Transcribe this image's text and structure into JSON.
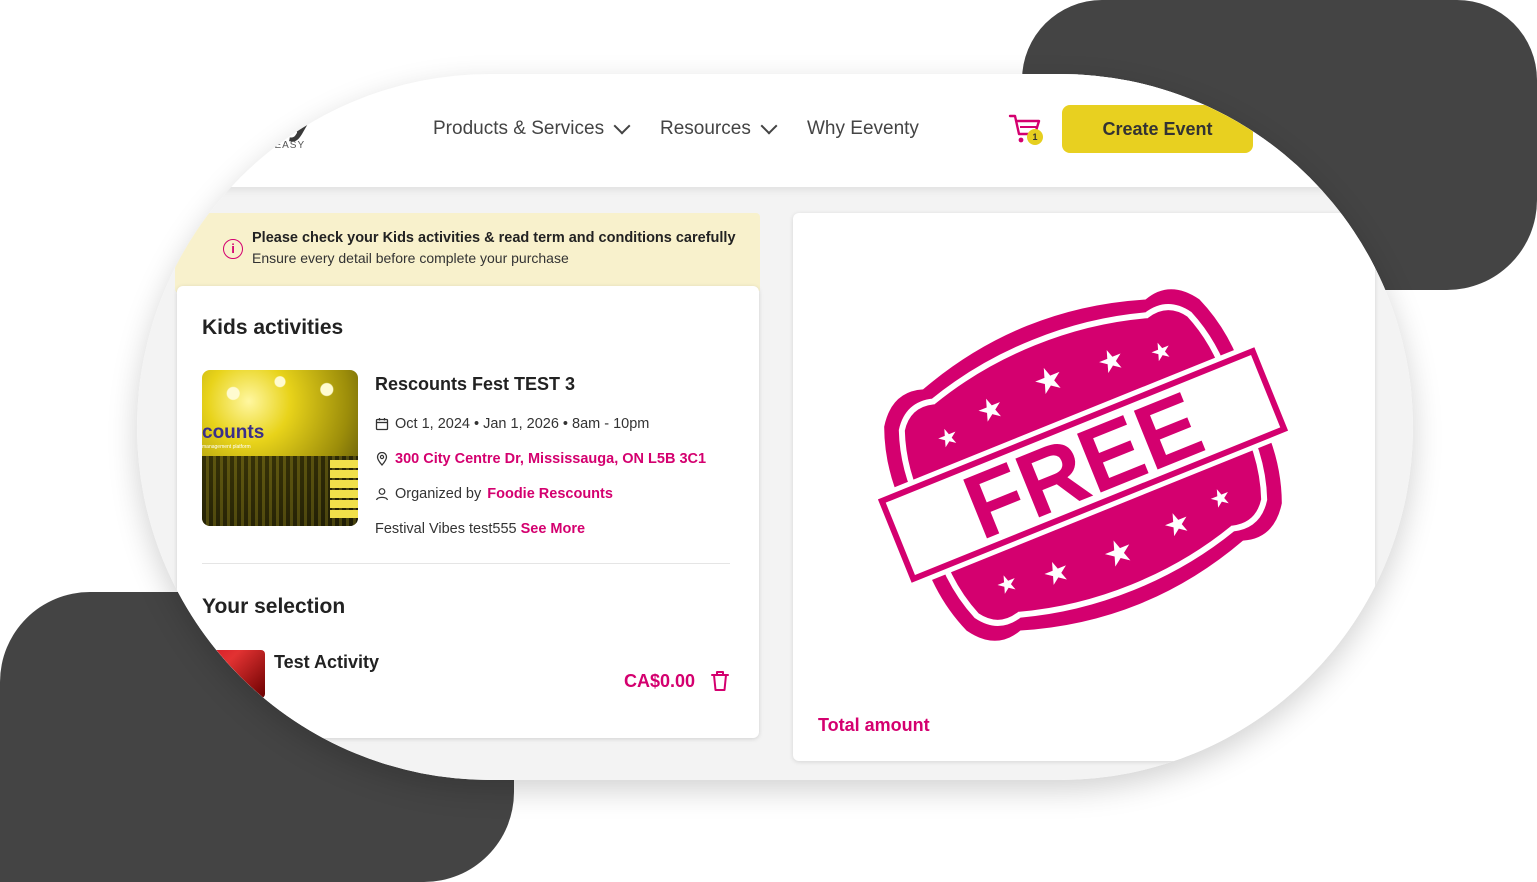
{
  "brand": {
    "logo_text": "nty",
    "tagline": "E EASY"
  },
  "nav": {
    "products": "Products & Services",
    "resources": "Resources",
    "why": "Why Eeventy",
    "cart_count": "1",
    "create_event": "Create Event"
  },
  "notice": {
    "title": "Please check your Kids activities & read term and conditions carefully",
    "subtitle": "Ensure every detail before complete your purchase",
    "icon": "info-icon"
  },
  "activity": {
    "section_title": "Kids activities",
    "event_title": "Rescounts Fest TEST 3",
    "dates": "Oct 1, 2024 • Jan 1, 2026 • 8am - 10pm",
    "address": "300 City Centre Dr, Mississauga, ON L5B 3C1",
    "organized_prefix": "Organized by",
    "organizer": "Foodie Rescounts",
    "description": "Festival Vibes test555",
    "see_more": "See More",
    "image_brand": "counts",
    "image_sub": "management platform"
  },
  "selection": {
    "title": "Your selection",
    "item_name": "Test Activity",
    "price": "CA$0.00"
  },
  "summary": {
    "stamp_text": "FREE",
    "total_label": "Total amount"
  },
  "colors": {
    "accent": "#d4006f",
    "button": "#e8d020",
    "blob": "#444444",
    "notice_bg": "#f8f1cc"
  }
}
